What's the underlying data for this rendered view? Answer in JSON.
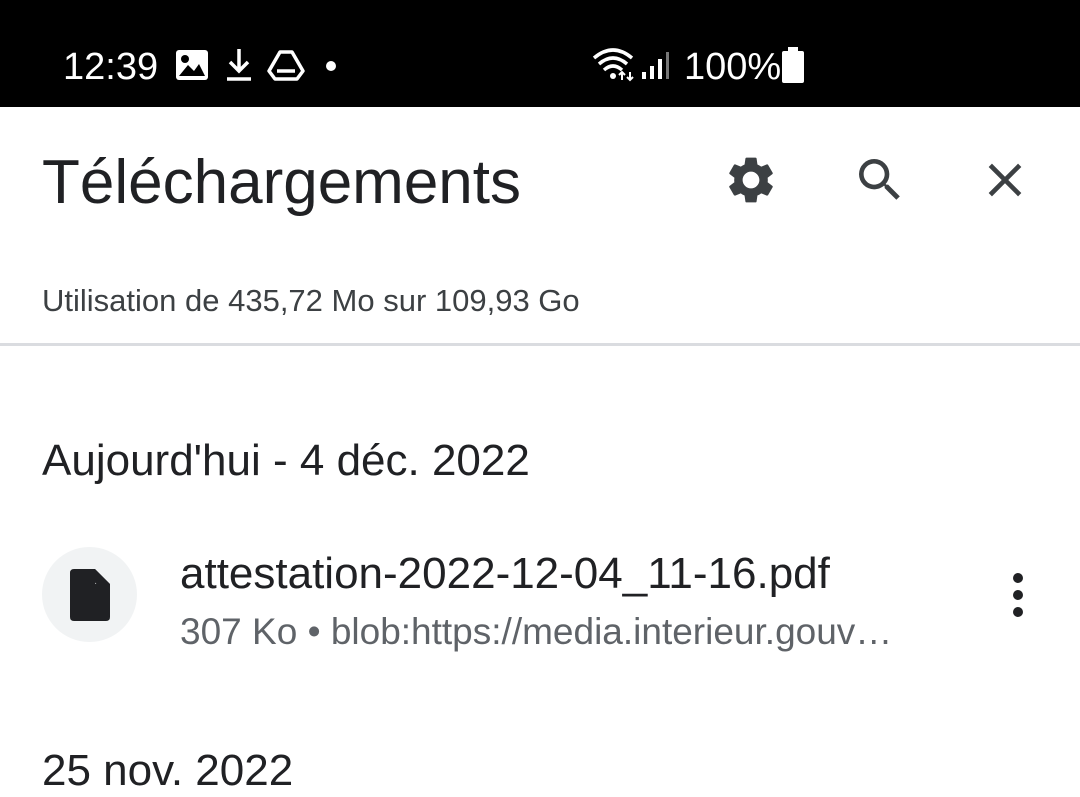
{
  "status_bar": {
    "time": "12:39",
    "battery": "100%",
    "icons": [
      "image-icon",
      "download-icon",
      "drive-icon",
      "notification-dot-icon",
      "wifi-icon",
      "signal-icon",
      "battery-icon"
    ]
  },
  "header": {
    "title": "Téléchargements",
    "actions": [
      "settings-icon",
      "search-icon",
      "close-icon"
    ]
  },
  "storage": {
    "text": "Utilisation de 435,72 Mo sur 109,93 Go"
  },
  "sections": [
    {
      "date_label": "Aujourd'hui - 4 déc. 2022",
      "items": [
        {
          "name": "attestation-2022-12-04_11-16.pdf",
          "size": "307 Ko",
          "separator": "•",
          "source": "blob:https://media.interieur.gouv…",
          "icon": "file-icon"
        }
      ]
    },
    {
      "date_label": "25 nov. 2022"
    }
  ],
  "colors": {
    "status_bar_bg": "#000000",
    "text_primary": "#202124",
    "text_secondary": "#5f6368",
    "divider": "#dadce0",
    "thumb_bg": "#f1f3f4"
  }
}
